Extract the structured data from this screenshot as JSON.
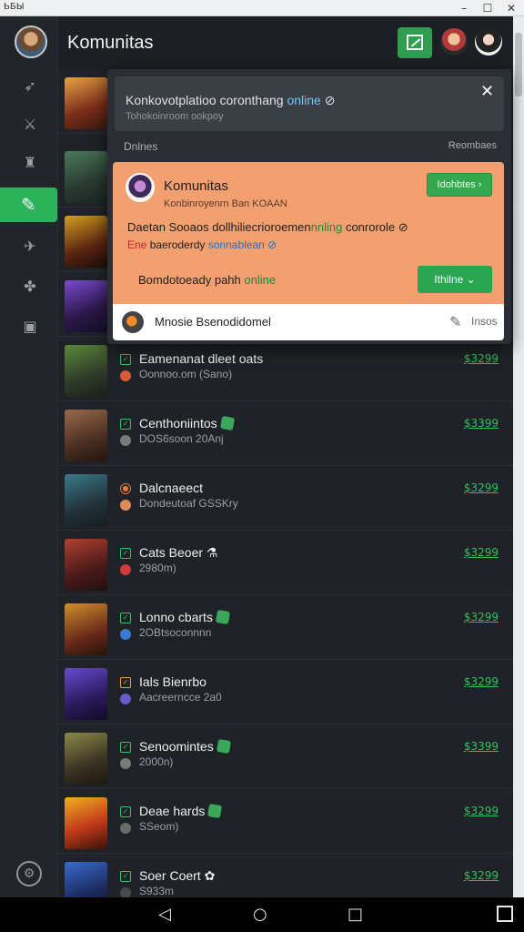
{
  "window": {
    "title": "ЬБЫ",
    "min": "–",
    "max": "☐",
    "close": "✕"
  },
  "header": {
    "title": "Komunitas"
  },
  "rail": {
    "bottom_icon": "⚙"
  },
  "overlay": {
    "top_msg_prefix": "Konkovotplatioo coronthang ",
    "top_msg_highlight": "online",
    "top_msg_suffix": " ⊘",
    "top_sub": "Tohokoinroom ookpoy",
    "close_icon": "✕",
    "section_left": "Dnlnes",
    "section_right": "Reombaes",
    "card": {
      "title": "Komunitas",
      "sub": "Konbinroyenrn Ban KOAAN",
      "button": "Idohbtes ›",
      "msg1_prefix": "Daetan Sooaos dollhiliecrioroemen",
      "msg1_highlight": "nnling",
      "msg1_suffix": " conrorole ⊘",
      "msg2_red": "Ene",
      "msg2_mid": " baeroderdy ",
      "msg2_blue": "sonnablean ⊘",
      "footer_prefix": "Bomdotoeady pahh ",
      "footer_highlight": "online",
      "button2": "Ithilne ⌄"
    },
    "input": {
      "text": "Mnosie Bsenodidomel",
      "send": "Insos"
    }
  },
  "games": [
    {
      "title": "Eamenanat dleet oats",
      "sub": "Oonnoo.om (Sano)",
      "price": "$3299",
      "badge": false
    },
    {
      "title": "Centhoniintos",
      "sub": "DOS6soon 20Anj",
      "price": "$3399",
      "badge": true
    },
    {
      "title": "Dalcnaeect",
      "sub": "Dondeutoaf GSSKry",
      "price": "$3299",
      "badge": false
    },
    {
      "title": "Cats Beoer ⚗",
      "sub": "2980m)",
      "price": "$3299",
      "badge": false
    },
    {
      "title": "Lonno cbarts",
      "sub": "2OBtsoconnnn",
      "price": "$3299",
      "badge": true
    },
    {
      "title": "Ials Bienrbo",
      "sub": "Aacreerncce 2a0",
      "price": "$3299",
      "badge": false
    },
    {
      "title": "Senoomintes",
      "sub": "2000n)",
      "price": "$3399",
      "badge": true
    },
    {
      "title": "Deae hards",
      "sub": "SSeom)",
      "price": "$3299",
      "badge": true
    },
    {
      "title": "Soer Coert ✿",
      "sub": "S933m",
      "price": "$3299",
      "badge": false
    }
  ],
  "navbar": {
    "back": "◁",
    "home": "○",
    "recent": "□"
  }
}
